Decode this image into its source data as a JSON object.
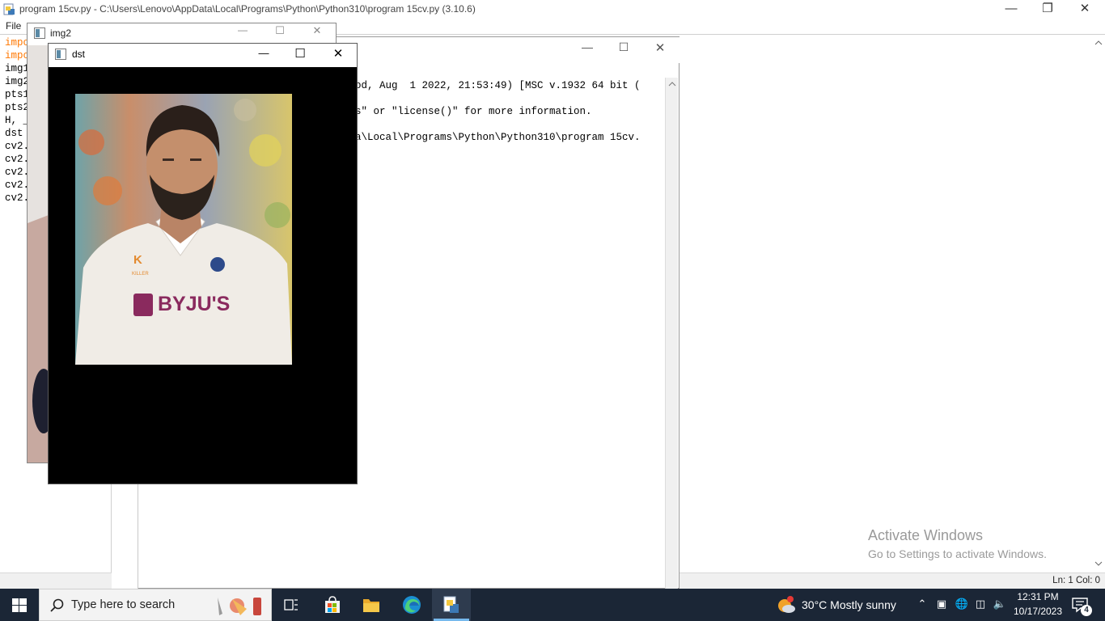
{
  "editor": {
    "title": "program 15cv.py - C:\\Users\\Lenovo\\AppData\\Local\\Programs\\Python\\Python310\\program 15cv.py (3.10.6)",
    "menu": [
      "File"
    ],
    "code_lines": [
      "impo",
      "impo",
      "img1",
      "img2",
      "pts1",
      "pts2",
      "H, _",
      "dst =",
      "cv2.",
      "cv2.",
      "cv2.",
      "cv2.",
      "cv2."
    ],
    "status": "Ln: 1   Col: 0"
  },
  "shell": {
    "lines": [
      "od, Aug  1 2022, 21:53:49) [MSC v.1932 64 bit (",
      "s\" or \"license()\" for more information.",
      "a\\Local\\Programs\\Python\\Python310\\program 15cv."
    ]
  },
  "img2_window": {
    "title": "img2"
  },
  "dst_window": {
    "title": "dst"
  },
  "photo": {
    "shirt_text": "BYJU'S",
    "collar_text": "KILLER"
  },
  "watermark": {
    "title": "Activate Windows",
    "subtitle": "Go to Settings to activate Windows."
  },
  "taskbar": {
    "search_placeholder": "Type here to search",
    "weather": "30°C  Mostly sunny",
    "time": "12:31 PM",
    "date": "10/17/2023",
    "notification_count": "4"
  },
  "colors": {
    "taskbar_bg": "#1b2636",
    "keyword": "#ff7700",
    "accent": "#76b9ed"
  }
}
